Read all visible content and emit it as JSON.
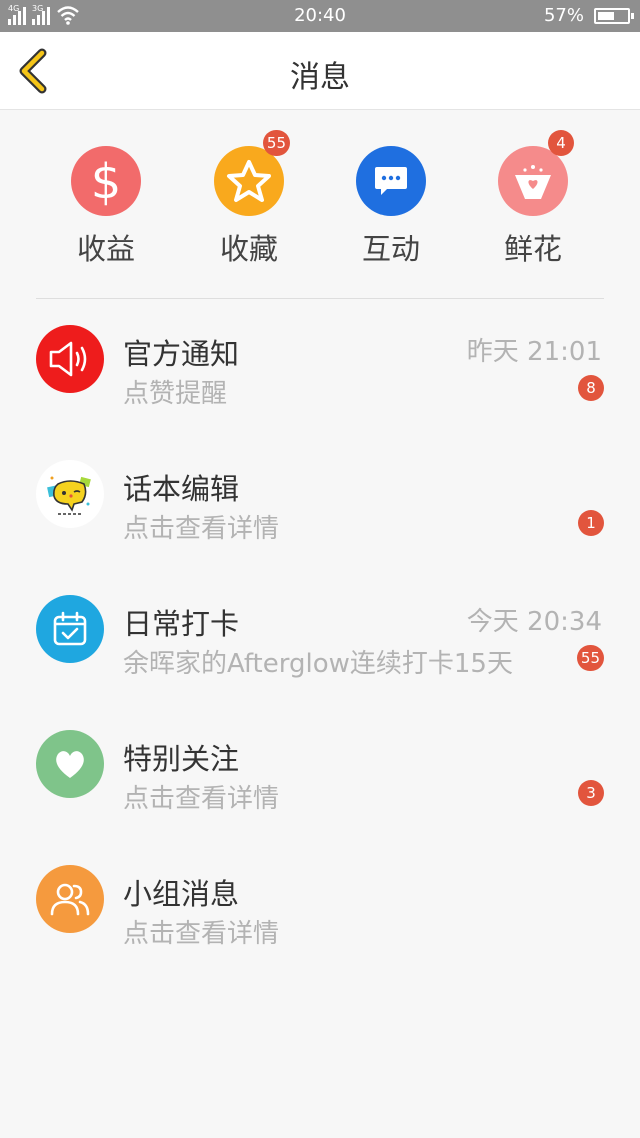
{
  "status_bar": {
    "network_1": "4G",
    "network_2": "3G",
    "time": "20:40",
    "battery_text": "57%",
    "battery_level": 0.57
  },
  "header": {
    "title": "消息",
    "back_icon": "chevron-left-icon",
    "accent_color": "#f5c518"
  },
  "quick_actions": [
    {
      "label": "收益",
      "icon": "dollar-icon",
      "color": "#f26b6b",
      "badge": ""
    },
    {
      "label": "收藏",
      "icon": "star-icon",
      "color": "#f9a91d",
      "badge": "55"
    },
    {
      "label": "互动",
      "icon": "chat-bubble-icon",
      "color": "#1f6fe0",
      "badge": ""
    },
    {
      "label": "鲜花",
      "icon": "bouquet-icon",
      "color": "#f58b8b",
      "badge": "4"
    }
  ],
  "messages": [
    {
      "title": "官方通知",
      "subtitle": "点赞提醒",
      "time": "昨天 21:01",
      "badge": "8",
      "icon": "speaker-icon",
      "color": "#ee1c1c"
    },
    {
      "title": "话本编辑",
      "subtitle": "点击查看详情",
      "time": "",
      "badge": "1",
      "icon": "mascot-icon",
      "color": "#ffffff"
    },
    {
      "title": "日常打卡",
      "subtitle": "余晖家的Afterglow连续打卡15天",
      "time": "今天 20:34",
      "badge": "55",
      "icon": "calendar-check-icon",
      "color": "#1fa7e0"
    },
    {
      "title": "特别关注",
      "subtitle": "点击查看详情",
      "time": "",
      "badge": "3",
      "icon": "heart-icon",
      "color": "#7fc48a"
    },
    {
      "title": "小组消息",
      "subtitle": "点击查看详情",
      "time": "",
      "badge": "",
      "icon": "group-icon",
      "color": "#f59a3e"
    }
  ]
}
